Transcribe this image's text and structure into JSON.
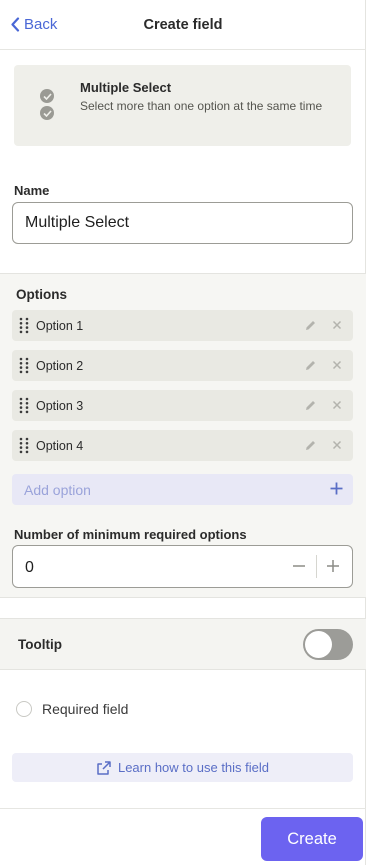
{
  "header": {
    "back_label": "Back",
    "title": "Create field"
  },
  "field_type": {
    "name": "Multiple Select",
    "description": "Select more than one option at the same time",
    "icon": "double-check-icon"
  },
  "name_field": {
    "label": "Name",
    "value": "Multiple Select"
  },
  "options": {
    "label": "Options",
    "items": [
      {
        "label": "Option 1"
      },
      {
        "label": "Option 2"
      },
      {
        "label": "Option 3"
      },
      {
        "label": "Option 4"
      }
    ],
    "add_placeholder": "Add option"
  },
  "min_required": {
    "label": "Number of minimum required options",
    "value": "0"
  },
  "tooltip": {
    "label": "Tooltip",
    "enabled": false
  },
  "required_field": {
    "label": "Required field",
    "checked": false
  },
  "learn_link": {
    "label": "Learn how to use this field"
  },
  "footer": {
    "create_label": "Create"
  },
  "colors": {
    "accent": "#6c63f0",
    "link": "#4a67d6",
    "card_bg": "#efefea",
    "option_bg": "#e9e9e3"
  }
}
